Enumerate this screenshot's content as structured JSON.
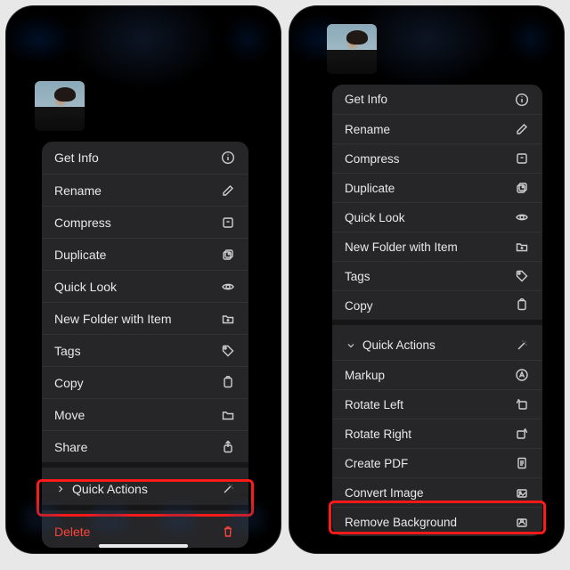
{
  "highlight_color": "#ff1a1a",
  "left": {
    "thumbnail": "selected-photo",
    "menu": [
      {
        "label": "Get Info",
        "icon": "info-icon"
      },
      {
        "label": "Rename",
        "icon": "pencil-icon"
      },
      {
        "label": "Compress",
        "icon": "archive-icon"
      },
      {
        "label": "Duplicate",
        "icon": "duplicate-icon"
      },
      {
        "label": "Quick Look",
        "icon": "eye-icon"
      },
      {
        "label": "New Folder with Item",
        "icon": "folder-plus-icon"
      },
      {
        "label": "Tags",
        "icon": "tag-icon"
      },
      {
        "label": "Copy",
        "icon": "copy-icon"
      },
      {
        "label": "Move",
        "icon": "folder-icon"
      },
      {
        "label": "Share",
        "icon": "share-icon"
      },
      {
        "label": "Quick Actions",
        "icon": "wand-icon",
        "submenu": true,
        "highlighted": true
      },
      {
        "label": "Delete",
        "icon": "trash-icon",
        "destructive": true
      }
    ]
  },
  "right": {
    "thumbnail": "selected-photo",
    "menu_top": [
      {
        "label": "Get Info",
        "icon": "info-icon"
      },
      {
        "label": "Rename",
        "icon": "pencil-icon"
      },
      {
        "label": "Compress",
        "icon": "archive-icon"
      },
      {
        "label": "Duplicate",
        "icon": "duplicate-icon"
      },
      {
        "label": "Quick Look",
        "icon": "eye-icon"
      },
      {
        "label": "New Folder with Item",
        "icon": "folder-plus-icon"
      },
      {
        "label": "Tags",
        "icon": "tag-icon"
      },
      {
        "label": "Copy",
        "icon": "copy-icon"
      }
    ],
    "section_header": {
      "label": "Quick Actions",
      "icon": "wand-icon"
    },
    "menu_bottom": [
      {
        "label": "Markup",
        "icon": "markup-icon"
      },
      {
        "label": "Rotate Left",
        "icon": "rotate-left-icon"
      },
      {
        "label": "Rotate Right",
        "icon": "rotate-right-icon"
      },
      {
        "label": "Create PDF",
        "icon": "pdf-icon"
      },
      {
        "label": "Convert Image",
        "icon": "convert-image-icon"
      },
      {
        "label": "Remove Background",
        "icon": "remove-bg-icon",
        "highlighted": true
      }
    ]
  }
}
